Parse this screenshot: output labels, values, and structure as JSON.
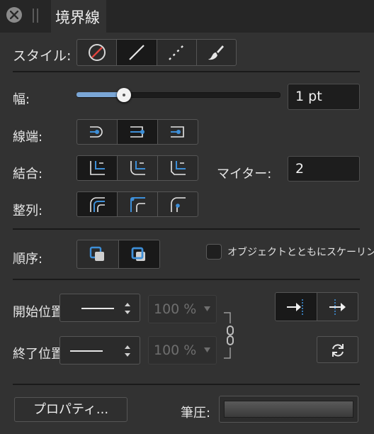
{
  "panel": {
    "tab_title": "境界線"
  },
  "style_row": {
    "label": "スタイル:"
  },
  "width_row": {
    "label": "幅:",
    "slider_value": 0.2,
    "value": "1 pt"
  },
  "cap_row": {
    "label": "線端:"
  },
  "join_row": {
    "label": "結合:",
    "miter_label": "マイター:",
    "miter_value": "2"
  },
  "align_row": {
    "label": "整列:"
  },
  "order_row": {
    "label": "順序:",
    "scale_checkbox_label": "オブジェクトとともにスケーリング"
  },
  "arrows": {
    "start_label": "開始位置:",
    "start_size": "100 %",
    "end_label": "終了位置",
    "end_size": "100 %"
  },
  "footer": {
    "properties_button": "プロパティ...",
    "pressure_label": "筆圧:"
  },
  "colors": {
    "accent": "#3e8fd8",
    "background": "#323232",
    "tabbar": "#262626"
  }
}
